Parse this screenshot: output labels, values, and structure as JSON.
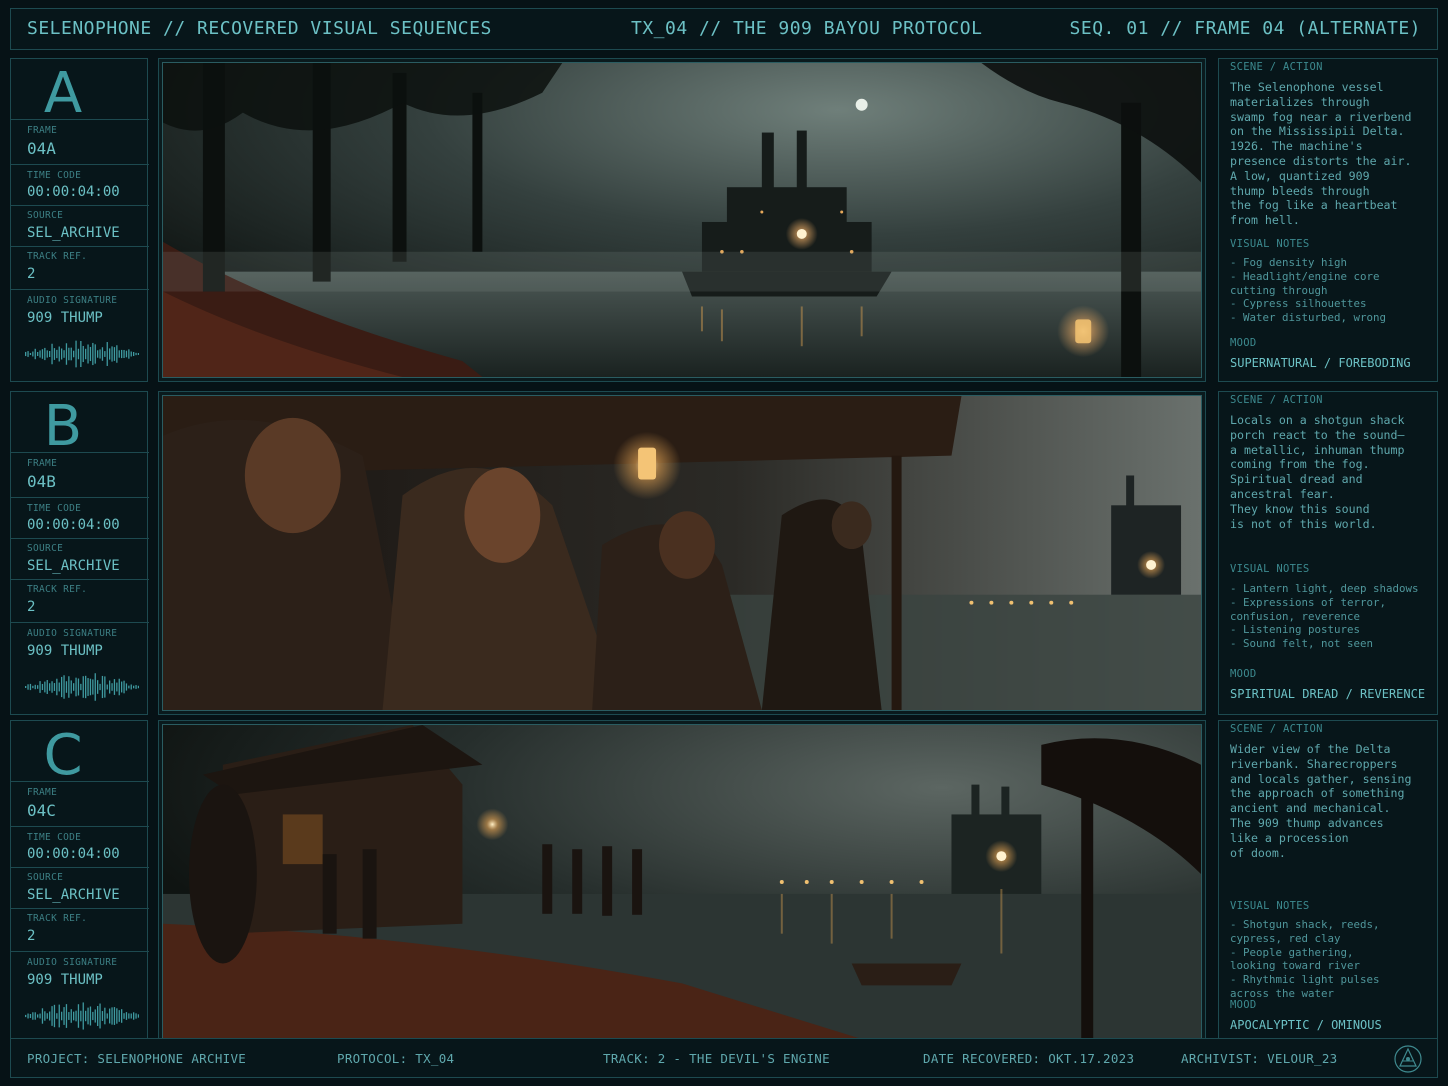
{
  "header": {
    "left": "SELENOPHONE // RECOVERED VISUAL SEQUENCES",
    "center": "TX_04 // THE 909 BAYOU PROTOCOL",
    "right": "SEQ. 01 // FRAME 04 (ALTERNATE)"
  },
  "labels": {
    "frame": "FRAME",
    "time_code": "TIME CODE",
    "source": "SOURCE",
    "track_ref": "TRACK REF.",
    "audio_signature": "AUDIO SIGNATURE",
    "scene_action": "SCENE / ACTION",
    "visual_notes": "VISUAL NOTES",
    "mood": "MOOD"
  },
  "frames": [
    {
      "letter": "A",
      "frame": "04A",
      "time_code": "00:00:04:00",
      "source": "SEL_ARCHIVE",
      "track_ref": "2",
      "audio_signature": "909 THUMP",
      "scene": "The Selenophone vessel\nmaterializes through\nswamp fog near a riverbend\non the Mississipii Delta.\n1926. The machine's\npresence distorts the air.\nA low, quantized 909\nthump bleeds through\nthe fog like a heartbeat\nfrom hell.",
      "visual_notes": "- Fog density high\n- Headlight/engine core\n  cutting through\n- Cypress silhouettes\n- Water disturbed, wrong",
      "mood": "SUPERNATURAL / FOREBODING"
    },
    {
      "letter": "B",
      "frame": "04B",
      "time_code": "00:00:04:00",
      "source": "SEL_ARCHIVE",
      "track_ref": "2",
      "audio_signature": "909 THUMP",
      "scene": "Locals on a shotgun shack\nporch react to the sound—\na metallic, inhuman thump\ncoming from the fog.\nSpiritual dread and\nancestral fear.\nThey know this sound\nis not of this world.",
      "visual_notes": "- Lantern light, deep shadows\n- Expressions of terror,\n  confusion, reverence\n- Listening postures\n- Sound felt, not seen",
      "mood": "SPIRITUAL DREAD / REVERENCE"
    },
    {
      "letter": "C",
      "frame": "04C",
      "time_code": "00:00:04:00",
      "source": "SEL_ARCHIVE",
      "track_ref": "2",
      "audio_signature": "909 THUMP",
      "scene": "Wider view of the Delta\nriverbank. Sharecroppers\nand locals gather, sensing\nthe approach of something\nancient and mechanical.\nThe 909 thump advances\nlike a procession\nof doom.",
      "visual_notes": "- Shotgun shack, reeds,\n  cypress, red clay\n- People gathering,\n  looking toward river\n- Rhythmic light pulses\n  across the water",
      "mood": "APOCALYPTIC / OMINOUS"
    }
  ],
  "footer": {
    "project": "PROJECT: SELENOPHONE ARCHIVE",
    "protocol": "PROTOCOL: TX_04",
    "track": "TRACK: 2 - THE DEVIL'S ENGINE",
    "date": "DATE RECOVERED: OKT.17.2023",
    "archivist": "ARCHIVIST: VELOUR_23"
  },
  "icons": [
    "waveform-icon",
    "archive-logo-icon"
  ],
  "colors": {
    "accent": "#6cc1c5",
    "border": "#1d4a50",
    "background": "#061216"
  }
}
